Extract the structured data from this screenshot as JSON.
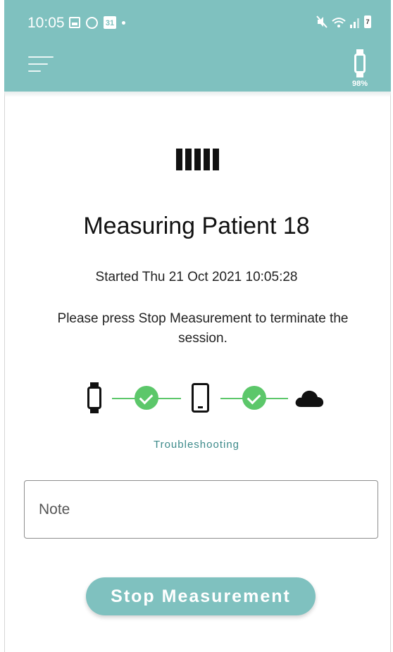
{
  "status_bar": {
    "time": "10:05",
    "calendar_day": "31",
    "phone_battery": "7"
  },
  "app_bar": {
    "menu_icon": "menu-icon",
    "device_icon": "watch-icon",
    "device_battery": "98%"
  },
  "session": {
    "title": "Measuring Patient 18",
    "started": "Started Thu 21 Oct 2021 10:05:28",
    "instructions": "Please press Stop Measurement to terminate the session."
  },
  "connection": {
    "watch_to_phone": "connected",
    "phone_to_cloud": "connected",
    "troubleshooting_link": "Troubleshooting"
  },
  "note": {
    "placeholder": "Note",
    "value": ""
  },
  "actions": {
    "stop_label": "Stop Measurement"
  },
  "colors": {
    "header": "#7fc1bf",
    "connected": "#5cc76a",
    "link": "#3d8a8a"
  }
}
